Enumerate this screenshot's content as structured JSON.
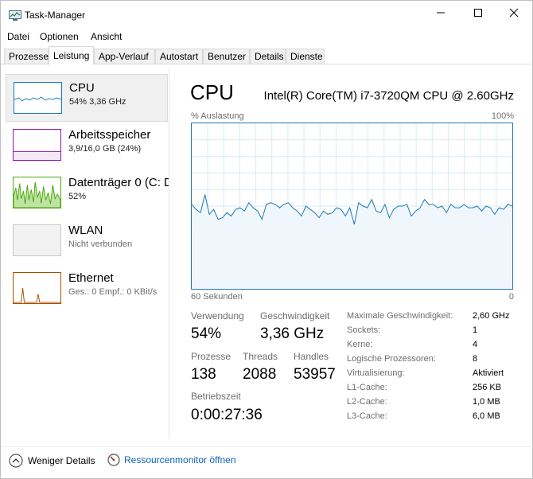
{
  "window": {
    "title": "Task-Manager"
  },
  "menu": [
    "Datei",
    "Optionen",
    "Ansicht"
  ],
  "tabs": [
    "Prozesse",
    "Leistung",
    "App-Verlauf",
    "Autostart",
    "Benutzer",
    "Details",
    "Dienste"
  ],
  "active_tab": "Leistung",
  "sidebar": {
    "items": [
      {
        "title": "CPU",
        "sub": "54% 3,36 GHz",
        "color": "#1979b8",
        "fill": "#f0f7fc"
      },
      {
        "title": "Arbeitsspeicher",
        "sub": "3,9/16,0 GB (24%)",
        "color": "#8b12ae",
        "fill": "#f4e8f7"
      },
      {
        "title": "Datenträger 0 (C: D",
        "sub": "52%",
        "color": "#4da60c",
        "fill": "#eaf5e0"
      },
      {
        "title": "WLAN",
        "sub": "Nicht verbunden",
        "color": "#a0a0a0",
        "fill": "#f2f2f2"
      },
      {
        "title": "Ethernet",
        "sub": "Ges.: 0 Empf.: 0 KBit/s",
        "color": "#a74f01",
        "fill": "#fbf0e6"
      }
    ]
  },
  "main": {
    "heading": "CPU",
    "model": "Intel(R) Core(TM) i7-3720QM CPU @ 2.60GHz",
    "graph_top_left": "% Auslastung",
    "graph_top_right": "100%",
    "graph_bottom_left": "60 Sekunden",
    "graph_bottom_right": "0",
    "cpu_history_percent": [
      51,
      48,
      46,
      57,
      45,
      48,
      42,
      43,
      46,
      44,
      48,
      49,
      47,
      52,
      49,
      47,
      42,
      51,
      52,
      51,
      49,
      51,
      52,
      49,
      47,
      44,
      50,
      48,
      46,
      43,
      47,
      45,
      46,
      49,
      48,
      44,
      49,
      39,
      52,
      50,
      49,
      54,
      47,
      46,
      51,
      43,
      48,
      50,
      50,
      51,
      44,
      47,
      49,
      54,
      51,
      51,
      49,
      50,
      46,
      51,
      49,
      49,
      51,
      49,
      49,
      50,
      47,
      50,
      49,
      45,
      49,
      48,
      51,
      50
    ],
    "stats": {
      "usage_label": "Verwendung",
      "usage_value": "54%",
      "speed_label": "Geschwindigkeit",
      "speed_value": "3,36 GHz",
      "processes_label": "Prozesse",
      "processes_value": "138",
      "threads_label": "Threads",
      "threads_value": "2088",
      "handles_label": "Handles",
      "handles_value": "53957",
      "uptime_label": "Betriebszeit",
      "uptime_value": "0:00:27:36"
    },
    "specs": [
      {
        "label": "Maximale Geschwindigkeit:",
        "value": "2,60 GHz"
      },
      {
        "label": "Sockets:",
        "value": "1"
      },
      {
        "label": "Kerne:",
        "value": "4"
      },
      {
        "label": "Logische Prozessoren:",
        "value": "8"
      },
      {
        "label": "Virtualisierung:",
        "value": "Aktiviert"
      },
      {
        "label": "L1-Cache:",
        "value": "256 KB"
      },
      {
        "label": "L2-Cache:",
        "value": "1,0 MB"
      },
      {
        "label": "L3-Cache:",
        "value": "6,0 MB"
      }
    ]
  },
  "footer": {
    "fewer_details": "Weniger Details",
    "resource_monitor": "Ressourcenmonitor öffnen"
  }
}
